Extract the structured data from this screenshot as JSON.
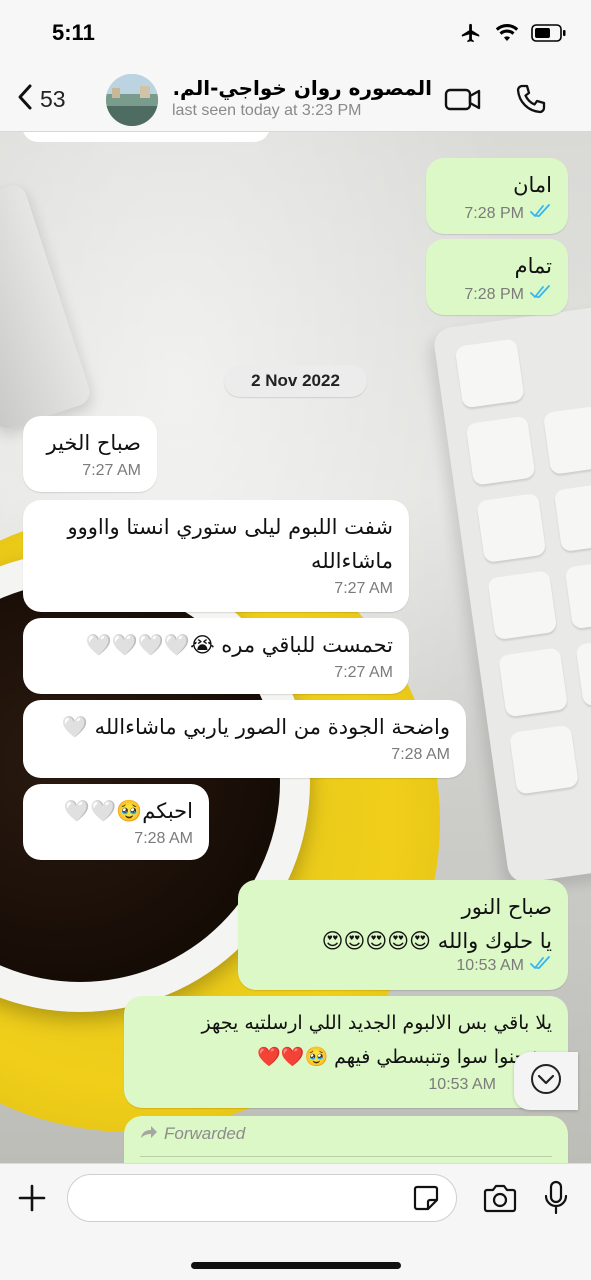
{
  "status_bar": {
    "time": "5:11"
  },
  "header": {
    "back_count": "53",
    "contact_name": "المصوره روان خواجي-الم...",
    "last_seen": "last seen today at 3:23 PM"
  },
  "chat": {
    "date_separator": "2 Nov 2022",
    "messages": [
      {
        "direction": "out",
        "text": "امان",
        "time": "7:28 PM",
        "read": true
      },
      {
        "direction": "out",
        "text": "تمام",
        "time": "7:28 PM",
        "read": true
      },
      {
        "direction": "in",
        "text": "صباح الخير",
        "time": "7:27 AM"
      },
      {
        "direction": "in",
        "text": "شفت اللبوم ليلى ستوري انستا وااووو ماشاءالله",
        "time": "7:27 AM"
      },
      {
        "direction": "in",
        "text": "تحمست للباقي مره 😭🤍🤍🤍🤍",
        "time": "7:27 AM"
      },
      {
        "direction": "in",
        "text": "واضحة الجودة من الصور ياربي ماشاءالله 🤍",
        "time": "7:28 AM"
      },
      {
        "direction": "in",
        "text": "احبكم🥹🤍🤍",
        "time": "7:28 AM"
      },
      {
        "direction": "out",
        "text_line1": "صباح النور",
        "text_line2": "يا حلوك والله 😍😍😍😍😍",
        "time": "10:53 AM",
        "read": true
      },
      {
        "direction": "out",
        "text_line1": "يلا باقي بس الالبوم الجديد اللي ارسلتيه يجهز",
        "text_line2": "وشحنوا سوا وتنبسطي فيهم 🥹❤️❤️",
        "time": "10:53 AM"
      },
      {
        "direction": "out",
        "forwarded_label": "Forwarded"
      }
    ]
  },
  "input": {
    "placeholder": ""
  },
  "colors": {
    "outgoing_bubble": "#dcf8c6",
    "incoming_bubble": "#ffffff",
    "read_tick": "#34b7f1",
    "accent": "#000000"
  },
  "icons": [
    "airplane-icon",
    "wifi-icon",
    "battery-icon",
    "chevron-left-icon",
    "video-call-icon",
    "phone-icon",
    "double-check-icon",
    "chevron-down-icon",
    "forward-arrow-icon",
    "plus-icon",
    "sticker-icon",
    "camera-icon",
    "microphone-icon"
  ]
}
